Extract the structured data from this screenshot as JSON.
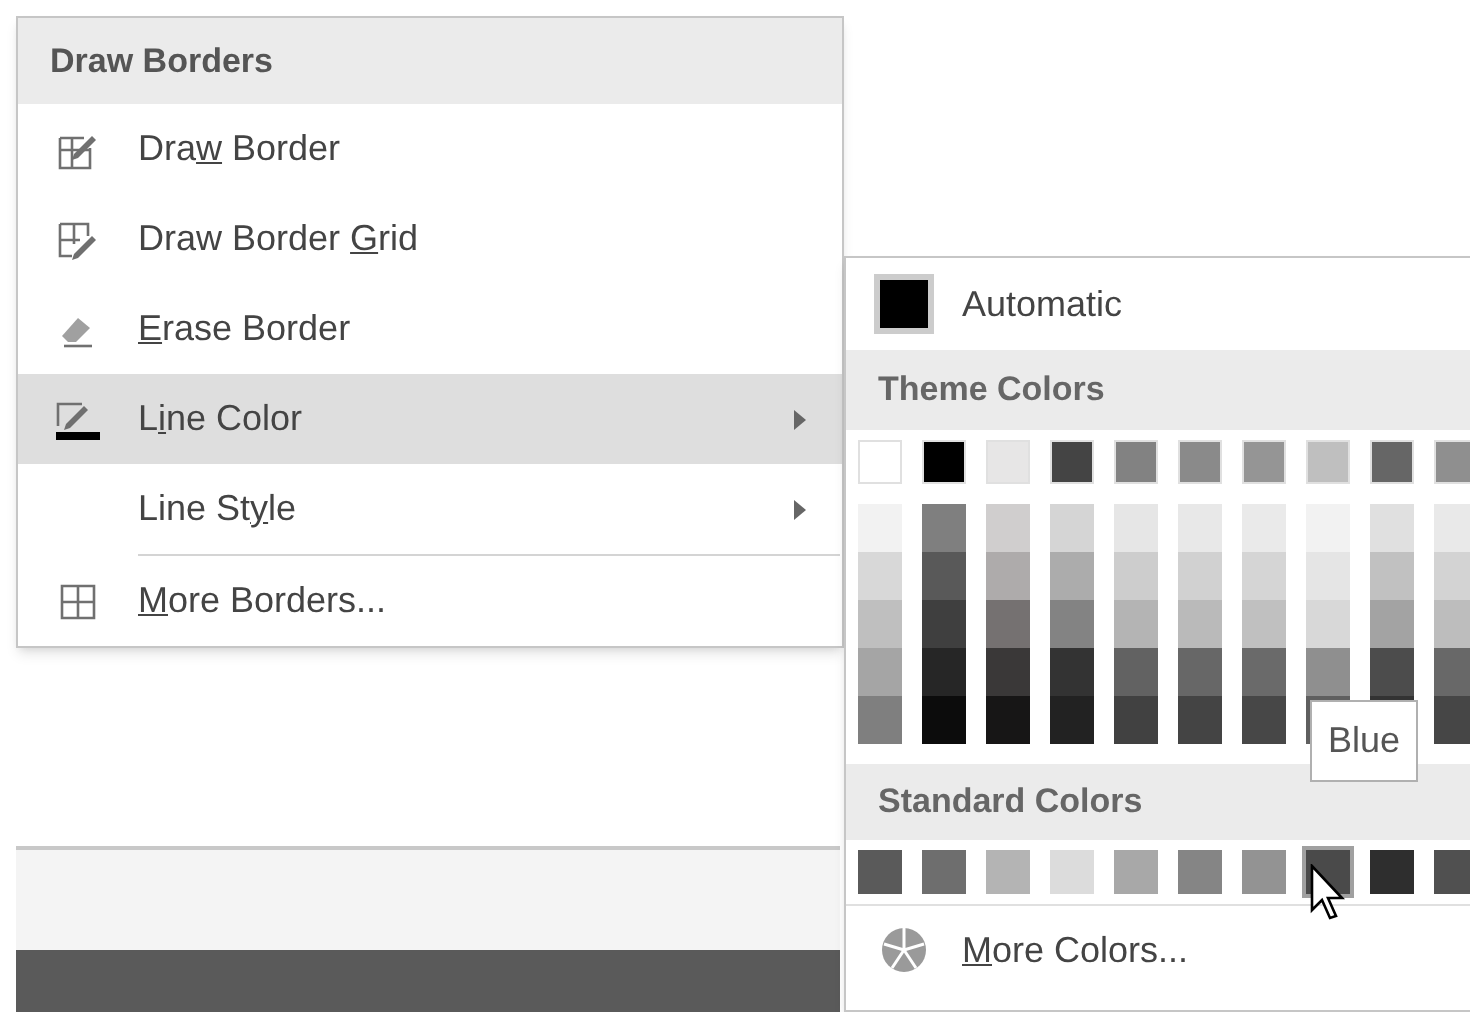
{
  "menu": {
    "header": "Draw Borders",
    "items": [
      {
        "label_before": "Dra",
        "access_key": "w",
        "label_after": " Border",
        "highlighted": false,
        "submenu": false
      },
      {
        "label_before": "Draw Border ",
        "access_key": "G",
        "label_after": "rid",
        "highlighted": false,
        "submenu": false
      },
      {
        "access_key": "E",
        "label_after": "rase Border",
        "highlighted": false,
        "submenu": false
      },
      {
        "label_before": "L",
        "access_key": "i",
        "label_after": "ne Color",
        "highlighted": true,
        "submenu": true
      },
      {
        "label_before": "Line St",
        "access_key": "y",
        "label_after": "le",
        "highlighted": false,
        "submenu": true
      },
      {
        "access_key": "M",
        "label_after": "ore Borders...",
        "highlighted": false,
        "submenu": false
      }
    ]
  },
  "color_menu": {
    "automatic": {
      "label": "Automatic",
      "color": "#000000"
    },
    "theme_header": "Theme Colors",
    "theme_colors": [
      {
        "color": "#ffffff"
      },
      {
        "color": "#000000"
      },
      {
        "color": "#e7e6e6"
      },
      {
        "color": "#444444"
      },
      {
        "color": "#828282"
      },
      {
        "color": "#8a8a8a"
      },
      {
        "color": "#959595"
      },
      {
        "color": "#bfbfbf"
      },
      {
        "color": "#666666"
      },
      {
        "color": "#8f8f8f"
      }
    ],
    "theme_shades": [
      {
        "shades": [
          {
            "color": "#f2f2f2"
          },
          {
            "color": "#d8d8d8"
          },
          {
            "color": "#bfbfbf"
          },
          {
            "color": "#a5a5a5"
          },
          {
            "color": "#7f7f7f"
          }
        ]
      },
      {
        "shades": [
          {
            "color": "#7f7f7f"
          },
          {
            "color": "#595959"
          },
          {
            "color": "#3f3f3f"
          },
          {
            "color": "#262626"
          },
          {
            "color": "#0c0c0c"
          }
        ]
      },
      {
        "shades": [
          {
            "color": "#d0cece"
          },
          {
            "color": "#aeabab"
          },
          {
            "color": "#757171"
          },
          {
            "color": "#3a3838"
          },
          {
            "color": "#171616"
          }
        ]
      },
      {
        "shades": [
          {
            "color": "#d5d5d5"
          },
          {
            "color": "#acacac"
          },
          {
            "color": "#838383"
          },
          {
            "color": "#333333"
          },
          {
            "color": "#222222"
          }
        ]
      },
      {
        "shades": [
          {
            "color": "#e6e6e6"
          },
          {
            "color": "#cdcdcd"
          },
          {
            "color": "#b4b4b4"
          },
          {
            "color": "#626262"
          },
          {
            "color": "#414141"
          }
        ]
      },
      {
        "shades": [
          {
            "color": "#e8e8e8"
          },
          {
            "color": "#d1d1d1"
          },
          {
            "color": "#bababa"
          },
          {
            "color": "#676767"
          },
          {
            "color": "#444444"
          }
        ]
      },
      {
        "shades": [
          {
            "color": "#eaeaea"
          },
          {
            "color": "#d5d5d5"
          },
          {
            "color": "#c0c0c0"
          },
          {
            "color": "#6a6a6a"
          },
          {
            "color": "#474747"
          }
        ]
      },
      {
        "shades": [
          {
            "color": "#f2f2f2"
          },
          {
            "color": "#e5e5e5"
          },
          {
            "color": "#d8d8d8"
          },
          {
            "color": "#8f8f8f"
          },
          {
            "color": "#5f5f5f"
          }
        ]
      },
      {
        "shades": [
          {
            "color": "#e0e0e0"
          },
          {
            "color": "#c1c1c1"
          },
          {
            "color": "#a3a3a3"
          },
          {
            "color": "#4c4c4c"
          },
          {
            "color": "#333333"
          }
        ]
      },
      {
        "shades": [
          {
            "color": "#e9e9e9"
          },
          {
            "color": "#d3d3d3"
          },
          {
            "color": "#bdbdbd"
          },
          {
            "color": "#686868"
          },
          {
            "color": "#464646"
          }
        ]
      }
    ],
    "standard_header": "Standard Colors",
    "standard_colors": [
      {
        "color": "#5a5a5a",
        "selected": false
      },
      {
        "color": "#6e6e6e",
        "selected": false
      },
      {
        "color": "#b4b4b4",
        "selected": false
      },
      {
        "color": "#dcdcdc",
        "selected": false
      },
      {
        "color": "#a8a8a8",
        "selected": false
      },
      {
        "color": "#858585",
        "selected": false
      },
      {
        "color": "#939393",
        "selected": false
      },
      {
        "color": "#4a4a4a",
        "selected": true
      },
      {
        "color": "#2e2e2e",
        "selected": false
      },
      {
        "color": "#505050",
        "selected": false
      }
    ],
    "more_colors": {
      "access_key": "M",
      "label_after": "ore Colors..."
    },
    "tooltip": "Blue"
  }
}
